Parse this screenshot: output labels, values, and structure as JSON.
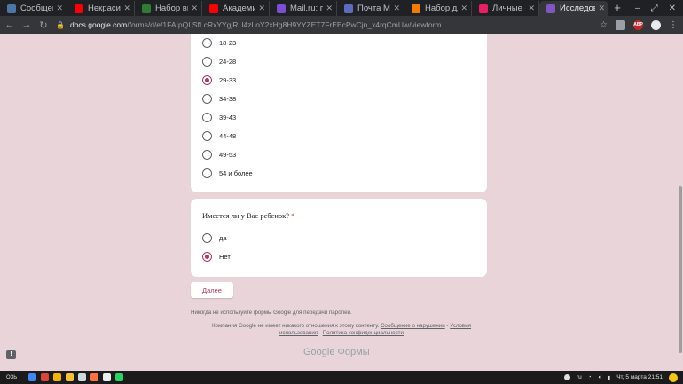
{
  "browser": {
    "tabs": [
      {
        "title": "Сообщения",
        "icon": "vk-icon",
        "color": "#4a76a8",
        "active": false
      },
      {
        "title": "Некрасивые",
        "icon": "youtube-icon",
        "color": "#ff0000",
        "active": false
      },
      {
        "title": "Набор вып",
        "icon": "k-icon",
        "color": "#2e7d32",
        "active": false
      },
      {
        "title": "Академия",
        "icon": "youtube-icon",
        "color": "#ff0000",
        "active": false
      },
      {
        "title": "Mail.ru: по",
        "icon": "mailru-icon",
        "color": "#7b4fd3",
        "active": false
      },
      {
        "title": "Почта Mail",
        "icon": "mail-icon",
        "color": "#5c6bc0",
        "active": false
      },
      {
        "title": "Набор для",
        "icon": "plus-icon",
        "color": "#f57c00",
        "active": false
      },
      {
        "title": "Личные со",
        "icon": "chat-icon",
        "color": "#e91e63",
        "active": false
      },
      {
        "title": "Исследов",
        "icon": "forms-icon",
        "color": "#7e57c2",
        "active": true
      }
    ],
    "new_tab": "+",
    "url_host": "docs.google.com",
    "url_path": "/forms/d/e/1FAIpQLSfLcRxYYgjRU4zLoY2xHg8H9YYZET7FrEEcPwCjn_x4rqCmUw/viewform"
  },
  "form": {
    "age_options": [
      {
        "label": "18-23",
        "selected": false
      },
      {
        "label": "24-28",
        "selected": false
      },
      {
        "label": "29-33",
        "selected": true
      },
      {
        "label": "34-38",
        "selected": false
      },
      {
        "label": "39-43",
        "selected": false
      },
      {
        "label": "44-48",
        "selected": false
      },
      {
        "label": "49-53",
        "selected": false
      },
      {
        "label": "54 и более",
        "selected": false
      }
    ],
    "q2_title": "Имеется ли у Вас ребенок?",
    "required_mark": "*",
    "q2_options": [
      {
        "label": "да",
        "selected": false
      },
      {
        "label": "Нет",
        "selected": true
      }
    ],
    "next_label": "Далее",
    "password_note": "Никогда не используйте формы Google для передачи паролей.",
    "footer_text": "Компания Google не имеет никакого отношения к этому контенту.",
    "footer_link_abuse": "Сообщение о нарушении",
    "footer_sep": "-",
    "footer_link_terms": "Условия использования",
    "footer_link_privacy": "Политика конфиденциальности",
    "brand_google": "Google",
    "brand_forms": "Формы"
  },
  "taskbar": {
    "start_label": "ОЗЬ",
    "lang": "ru",
    "date_time": "Чт, 5 марта 21:51"
  },
  "colors": {
    "accent": "#b0385a",
    "page_bg": "#e8d4d9"
  }
}
